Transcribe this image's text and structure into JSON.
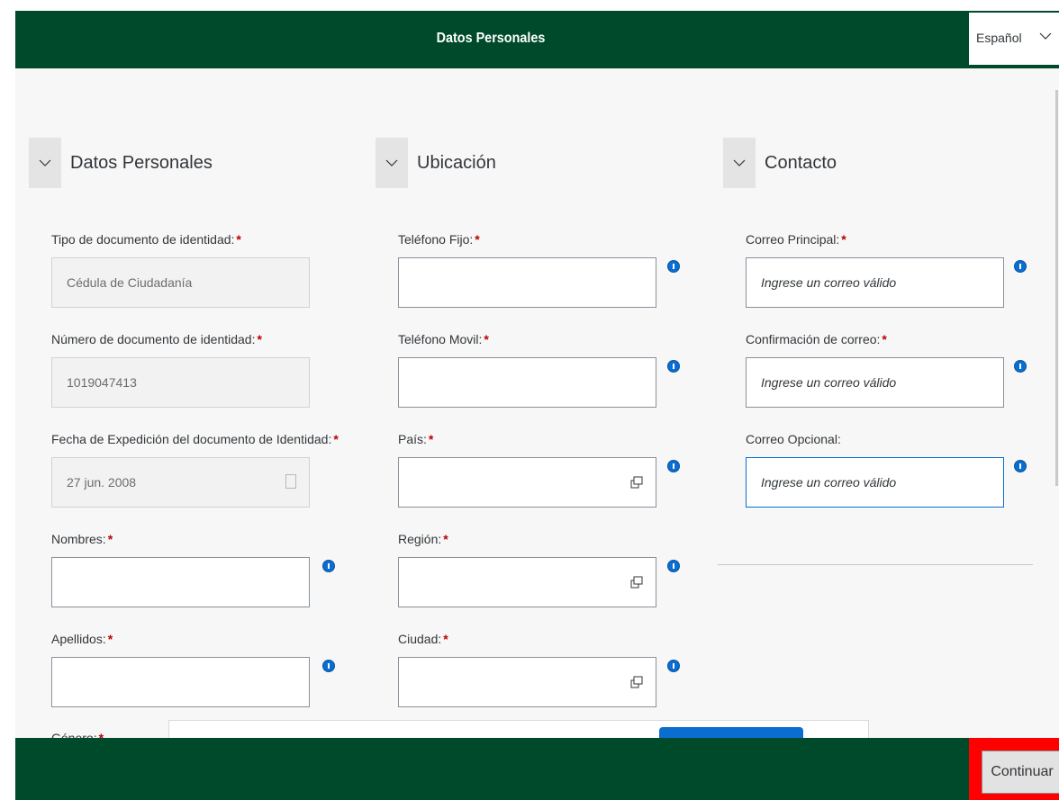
{
  "header": {
    "title": "Datos Personales",
    "language": "Español"
  },
  "sections": {
    "personal": "Datos Personales",
    "location": "Ubicación",
    "contact": "Contacto"
  },
  "personal": {
    "doc_type_label": "Tipo de documento de identidad:",
    "doc_type_value": "Cédula de Ciudadanía",
    "doc_number_label": "Número de documento de identidad:",
    "doc_number_value": "1019047413",
    "doc_date_label": "Fecha de Expedición del documento de Identidad:",
    "doc_date_value": "27 jun. 2008",
    "names_label": "Nombres:",
    "surnames_label": "Apellidos:",
    "gender_label": "Género:"
  },
  "location": {
    "phone_label": "Teléfono Fijo:",
    "mobile_label": "Teléfono Movil:",
    "country_label": "País:",
    "region_label": "Región:",
    "city_label": "Ciudad:"
  },
  "contact": {
    "email_label": "Correo Principal:",
    "email_placeholder": "Ingrese un correo válido",
    "confirm_label": "Confirmación de correo:",
    "confirm_placeholder": "Ingrese un correo válido",
    "optional_label": "Correo Opcional:",
    "optional_placeholder": "Ingrese un correo válido"
  },
  "required_mark": "*",
  "footer": {
    "continue_label": "Continuar"
  },
  "colors": {
    "brand": "#004a2c",
    "required": "#bb0000",
    "info": "#0a6ed1",
    "highlight": "#ff0000"
  }
}
